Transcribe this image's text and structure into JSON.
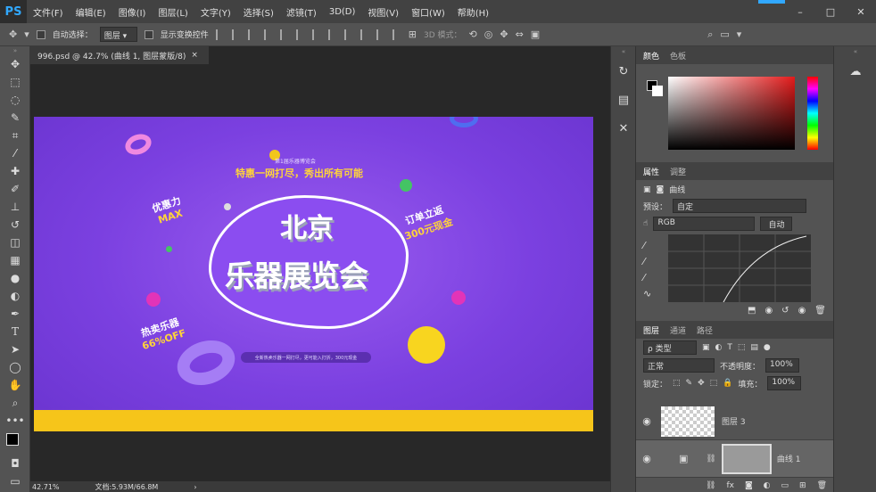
{
  "app": {
    "logo": "PS"
  },
  "menu": [
    "文件(F)",
    "编辑(E)",
    "图像(I)",
    "图层(L)",
    "文字(Y)",
    "选择(S)",
    "滤镜(T)",
    "3D(D)",
    "视图(V)",
    "窗口(W)",
    "帮助(H)"
  ],
  "options": {
    "auto_select": "自动选择：",
    "layer_select": "图层",
    "show_transform": "显示变换控件",
    "mode_3d": "3D 模式："
  },
  "document": {
    "tab_title": "996.psd @ 42.7% (曲线 1, 图层蒙版/8)",
    "close": "×"
  },
  "canvas": {
    "top_small": "第1届乐器博览会",
    "headline": "特惠一网打尽，秀出所有可能",
    "badge_left_top": "优惠力",
    "badge_left_max": "MAX",
    "title_line1": "北京",
    "title_line2": "乐器展览会",
    "badge_right_1": "订单立返",
    "badge_right_2": "300元现金",
    "badge_left_bottom_1": "热卖乐器",
    "badge_left_bottom_2": "66%OFF",
    "pill_text": "全新热卖乐器一网打尽，更可能入打折，300元现金"
  },
  "status": {
    "zoom": "42.71%",
    "doc_info": "文档:5.93M/66.8M"
  },
  "color_panel": {
    "tabs": [
      "颜色",
      "色板"
    ]
  },
  "properties_panel": {
    "tabs": [
      "属性",
      "调整"
    ],
    "title": "曲线",
    "preset_label": "预设：",
    "preset_value": "自定",
    "channel": "RGB",
    "auto": "自动"
  },
  "layers_panel": {
    "tabs": [
      "图层",
      "通道",
      "路径"
    ],
    "filter": "ρ 类型",
    "blend_mode": "正常",
    "opacity_label": "不透明度：",
    "opacity": "100%",
    "lock_label": "锁定：",
    "fill_label": "填充：",
    "fill": "100%",
    "layers": [
      {
        "name": "图层 3"
      },
      {
        "name": "曲线 1"
      }
    ]
  },
  "colors": {
    "canvas_purple": "#7b40e0",
    "wave_yellow": "#f6c51a",
    "accent": "#31a8ff"
  }
}
